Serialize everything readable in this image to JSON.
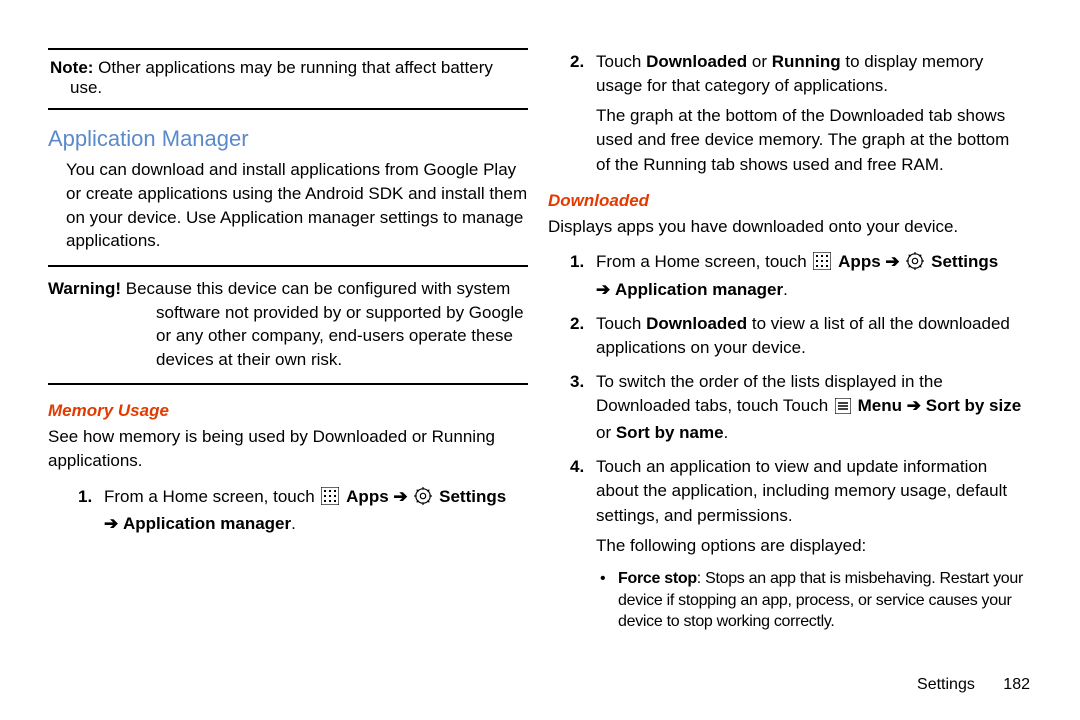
{
  "left": {
    "note_label": "Note:",
    "note_text": " Other applications may be running that affect battery",
    "note_line2": "use.",
    "h_app_manager": "Application Manager",
    "p_app_manager": "You can download and install applications from Google Play or create applications using the Android SDK and install them on your device. Use Application manager settings to manage applications.",
    "warn_label": "Warning!",
    "warn_text": " Because this device can be configured with system software not provided by or supported by Google or any other company, end-users operate these devices at their own risk.",
    "sub_memory": "Memory Usage",
    "p_memory": "See how memory is being used by Downloaded or Running applications.",
    "step1_pre": "From a Home screen, touch ",
    "apps_label": " Apps ",
    "settings_label": " Settings ",
    "appmgr_label": " Application manager"
  },
  "right": {
    "step2_a": "Touch ",
    "step2_b": "Downloaded",
    "step2_c": " or ",
    "step2_d": "Running",
    "step2_e": " to display memory usage for that category of applications.",
    "step2_f": "The graph at the bottom of the Downloaded tab shows used and free device memory. The graph at the bottom of the Running tab shows used and free RAM.",
    "sub_downloaded": "Downloaded",
    "p_downloaded": "Displays apps you have downloaded onto your device.",
    "d1_pre": "From a Home screen, touch ",
    "d2_a": "Touch ",
    "d2_b": "Downloaded",
    "d2_c": " to view a list of all the downloaded applications on your device.",
    "d3_a": "To switch the order of the lists displayed in the Downloaded tabs, touch Touch ",
    "d3_menu": " Menu ",
    "d3_sortsize": " Sort by size",
    "d3_or": " or ",
    "d3_sortname": "Sort by name",
    "d4": "Touch an application to view and update information about the application, including memory usage, default settings, and permissions.",
    "d4_after": "The following options are displayed:",
    "bullet_label": "Force stop",
    "bullet_text": ": Stops an app that is misbehaving. Restart your device if stopping an app, process, or service causes your device to stop working correctly."
  },
  "footer": {
    "section": "Settings",
    "page": "182"
  },
  "glyph": {
    "arrow": "➔"
  }
}
